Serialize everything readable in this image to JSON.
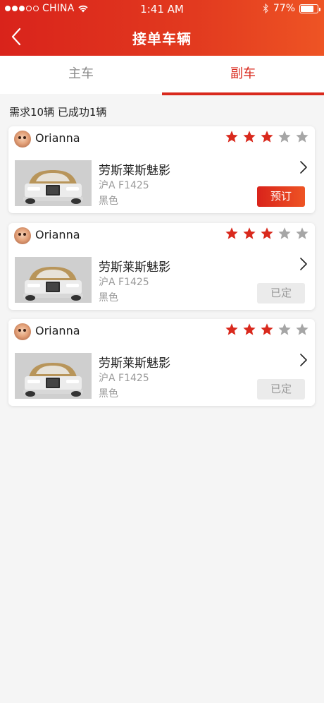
{
  "status_bar": {
    "carrier": "CHINA",
    "time": "1:41 AM",
    "battery": "77%",
    "battery_level": 0.77,
    "signal_dots_filled": 3,
    "signal_dots_total": 5,
    "icons": [
      "wifi-icon",
      "bluetooth-icon",
      "battery-icon"
    ]
  },
  "nav": {
    "title": "接单车辆",
    "back_icon": "chevron-left-icon"
  },
  "tabs": [
    {
      "label": "主车",
      "active": false
    },
    {
      "label": "副车",
      "active": true
    }
  ],
  "summary": "需求10辆 已成功1辆",
  "colors": {
    "brand": "#d9291d",
    "star_on": "#d9291d",
    "star_off": "#a6a6a6"
  },
  "cards": [
    {
      "username": "Orianna",
      "rating": 3,
      "rating_max": 5,
      "car_name": "劳斯莱斯魅影",
      "plate": "沪A F1425",
      "color": "黑色",
      "button_label": "预订",
      "button_state": "primary"
    },
    {
      "username": "Orianna",
      "rating": 3,
      "rating_max": 5,
      "car_name": "劳斯莱斯魅影",
      "plate": "沪A F1425",
      "color": "黑色",
      "button_label": "已定",
      "button_state": "disabled"
    },
    {
      "username": "Orianna",
      "rating": 3,
      "rating_max": 5,
      "car_name": "劳斯莱斯魅影",
      "plate": "沪A F1425",
      "color": "黑色",
      "button_label": "已定",
      "button_state": "disabled"
    }
  ]
}
